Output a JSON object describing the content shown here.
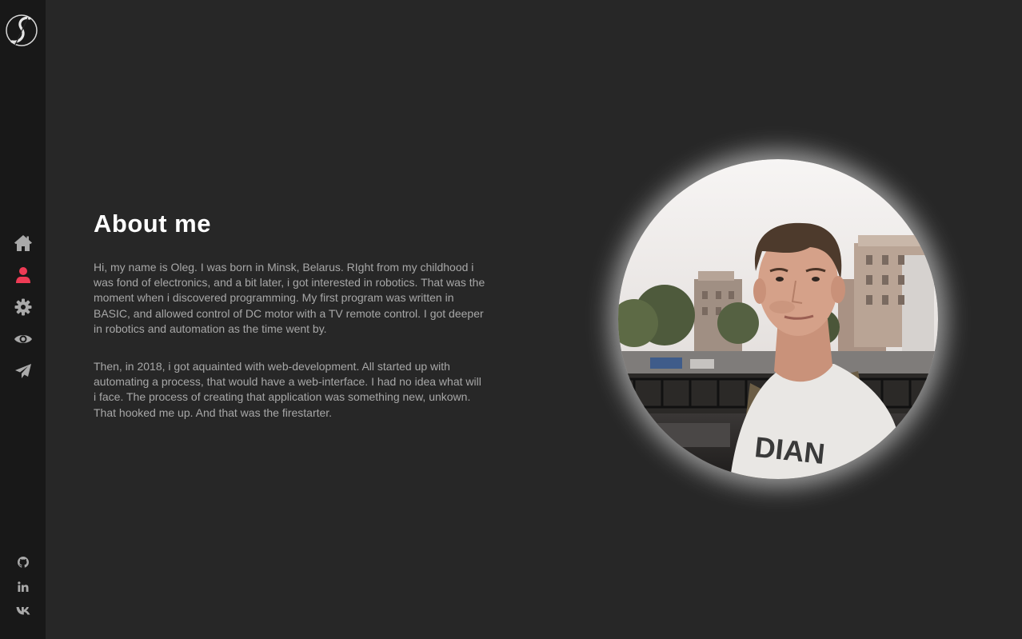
{
  "sidebar": {
    "logo_icon": "script-s-logo",
    "nav": [
      {
        "icon": "home-icon",
        "label": "Home",
        "active": false
      },
      {
        "icon": "user-icon",
        "label": "About",
        "active": true
      },
      {
        "icon": "gear-icon",
        "label": "Skills",
        "active": false
      },
      {
        "icon": "eye-icon",
        "label": "Portfolio",
        "active": false
      },
      {
        "icon": "paper-plane-icon",
        "label": "Contact",
        "active": false
      }
    ],
    "social": [
      {
        "icon": "github-icon"
      },
      {
        "icon": "linkedin-icon"
      },
      {
        "icon": "vk-icon"
      }
    ]
  },
  "about": {
    "title": "About me",
    "paragraph1": "Hi, my name is Oleg. I was born in Minsk, Belarus. RIght from my childhood i was fond of electronics, and a bit later, i got interested in robotics. That was the moment when i discovered programming. My first program was written in BASIC, and allowed control of DC motor with a TV remote control. I got deeper in robotics and automation as the time went by.",
    "paragraph2": "Then, in 2018, i got aquainted with web-development. All started up with automating a process, that would have a web-interface. I had no idea what will i face. The process of creating that application was something new, unkown. That hooked me up. And that was the firestarter."
  },
  "colors": {
    "background": "#272727",
    "sidebar": "#181818",
    "accent": "#ee3b55",
    "icon": "#a9a9a9",
    "text_muted": "#a7a7a7",
    "title": "#ffffff"
  }
}
